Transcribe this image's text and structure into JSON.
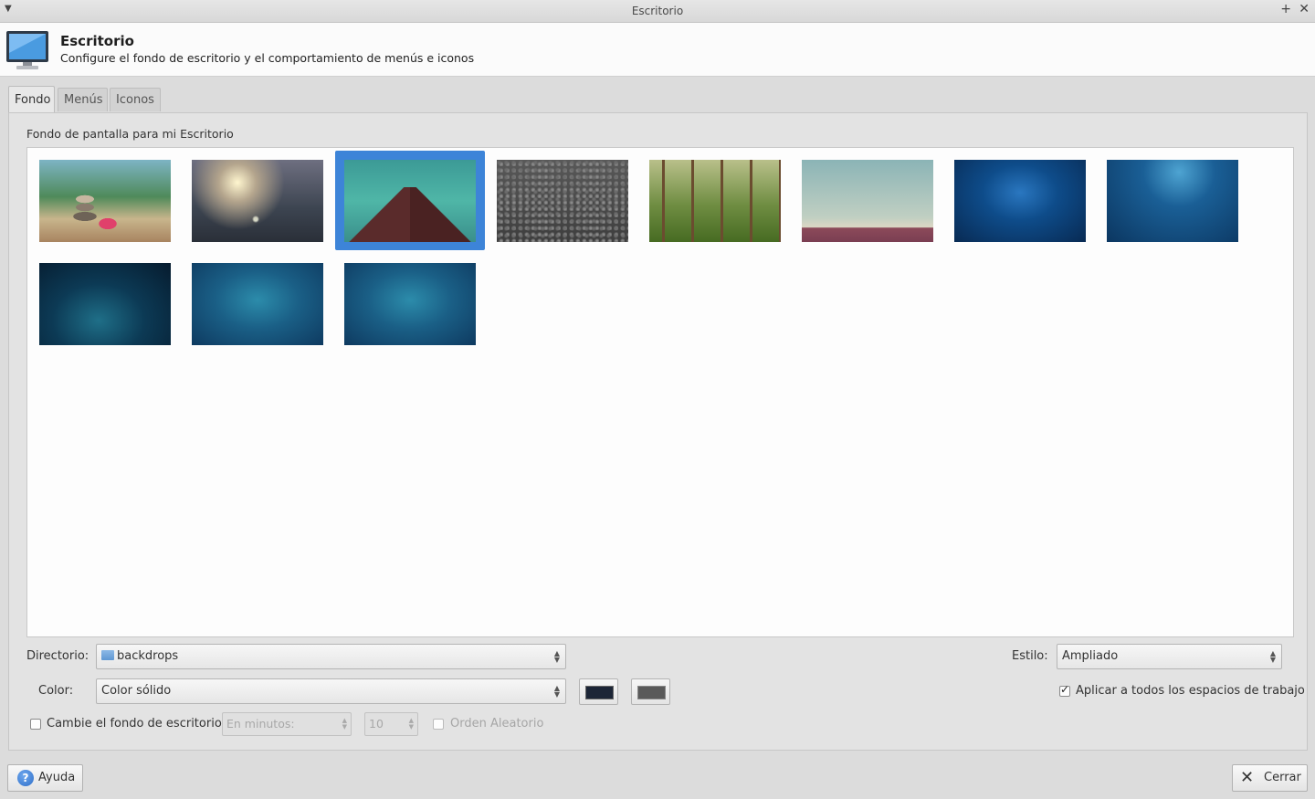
{
  "window": {
    "title": "Escritorio"
  },
  "header": {
    "title": "Escritorio",
    "subtitle": "Configure el fondo de escritorio y el comportamiento de menús e iconos"
  },
  "tabs": [
    {
      "label": "Fondo",
      "active": true
    },
    {
      "label": "Menús",
      "active": false
    },
    {
      "label": "Iconos",
      "active": false
    }
  ],
  "background": {
    "section_label": "Fondo de pantalla para mi Escritorio",
    "selected_index": 2,
    "wallpapers": [
      {
        "name": "zen-stones-wallpaper"
      },
      {
        "name": "flowers-bokeh-wallpaper"
      },
      {
        "name": "mountain-peak-wallpaper"
      },
      {
        "name": "pebbles-wallpaper"
      },
      {
        "name": "forest-wallpaper"
      },
      {
        "name": "horizon-wallpaper"
      },
      {
        "name": "blue-glow-wallpaper"
      },
      {
        "name": "blue-light-wallpaper"
      },
      {
        "name": "dark-teal-wallpaper"
      },
      {
        "name": "teal-wallpaper-1"
      },
      {
        "name": "teal-wallpaper-2"
      }
    ]
  },
  "form": {
    "directory_label": "Directorio:",
    "directory_value": "backdrops",
    "style_label": "Estilo:",
    "style_value": "Ampliado",
    "color_label": "Color:",
    "color_value": "Color sólido",
    "primary_color": "#1c2536",
    "secondary_color": "#5a5a5a",
    "apply_all_label": "Aplicar a todos los espacios de trabajo",
    "apply_all_checked": true,
    "change_bg_label": "Cambie el fondo de escritorio:",
    "change_bg_checked": false,
    "interval_value": "En minutos:",
    "minutes_value": "10",
    "random_order_label": "Orden Aleatorio",
    "random_order_checked": false
  },
  "buttons": {
    "help_label": "Ayuda",
    "close_label": "Cerrar"
  }
}
